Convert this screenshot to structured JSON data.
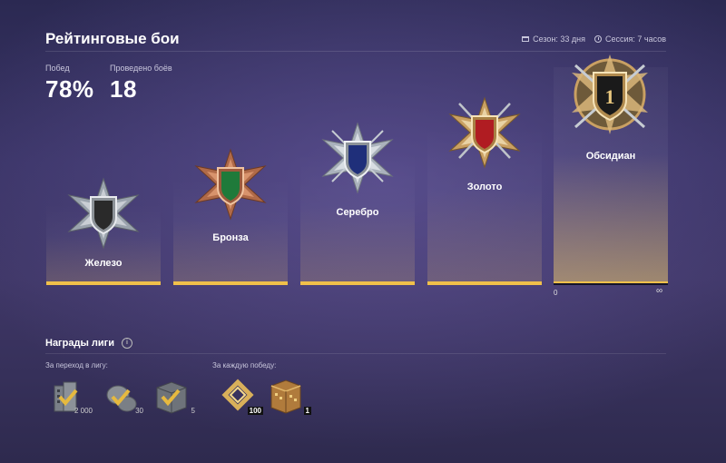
{
  "header": {
    "title": "Рейтинговые бои",
    "season": "Сезон: 33 дня",
    "session": "Сессия: 7 часов"
  },
  "stats": {
    "wins_label": "Побед",
    "wins_value": "78%",
    "battles_label": "Проведено боёв",
    "battles_value": "18"
  },
  "leagues": [
    {
      "name": "Железо",
      "shield_color": "#2a2a2a",
      "medal": "silver"
    },
    {
      "name": "Бронза",
      "shield_color": "#1f7a3a",
      "medal": "bronze"
    },
    {
      "name": "Серебро",
      "shield_color": "#1f2f7a",
      "medal": "silver"
    },
    {
      "name": "Золото",
      "shield_color": "#b01c22",
      "medal": "gold"
    },
    {
      "name": "Обсидиан",
      "shield_color": "#1a1a1a",
      "medal": "gold",
      "rank": "1"
    }
  ],
  "progress": {
    "min": "0",
    "max": "∞"
  },
  "rewards": {
    "title": "Награды лиги",
    "transition_label": "За переход в лигу:",
    "per_win_label": "За каждую победу:",
    "transition_items": [
      {
        "icon": "building-icon",
        "qty": "2 000"
      },
      {
        "icon": "medallion-icon",
        "qty": "30"
      },
      {
        "icon": "crate-icon",
        "qty": "5"
      }
    ],
    "per_win_items": [
      {
        "icon": "diamond-token-icon",
        "qty": "100"
      },
      {
        "icon": "gold-container-icon",
        "qty": "1"
      }
    ]
  },
  "colors": {
    "accent": "#f0c04a"
  }
}
